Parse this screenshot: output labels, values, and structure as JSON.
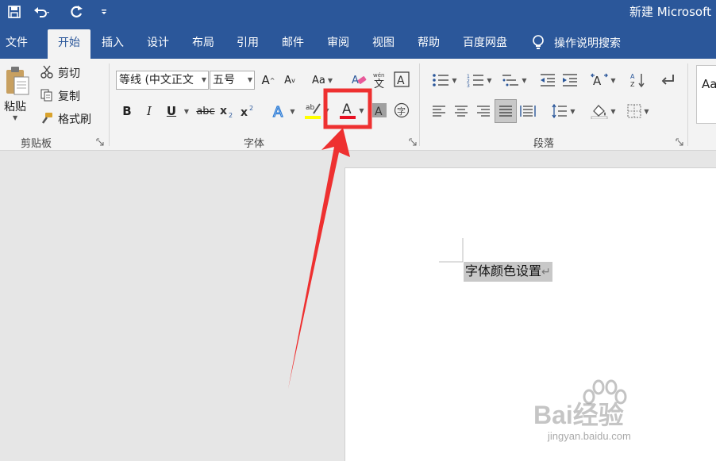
{
  "titlebar": {
    "title": "新建 Microsoft"
  },
  "tabs": [
    "文件",
    "开始",
    "插入",
    "设计",
    "布局",
    "引用",
    "邮件",
    "审阅",
    "视图",
    "帮助",
    "百度网盘"
  ],
  "tell_me": "操作说明搜索",
  "clipboard": {
    "paste": "粘贴",
    "cut": "剪切",
    "copy": "复制",
    "format_painter": "格式刷",
    "group_label": "剪贴板"
  },
  "font": {
    "font_name": "等线 (中文正文",
    "font_size": "五号",
    "bold": "B",
    "italic": "I",
    "underline": "U",
    "strikethrough": "abc",
    "change_case": "Aa",
    "group_label": "字体",
    "font_color_accent": "#e81123",
    "highlight_accent": "#ffff00"
  },
  "paragraph": {
    "group_label": "段落"
  },
  "styles": {
    "preview": "Aa"
  },
  "document": {
    "text": "字体颜色设置"
  },
  "watermark": {
    "brand": "Bai经验",
    "url": "jingyan.baidu.com"
  },
  "colors": {
    "ribbon_blue": "#2b579a",
    "highlight_red": "#ee3030"
  }
}
